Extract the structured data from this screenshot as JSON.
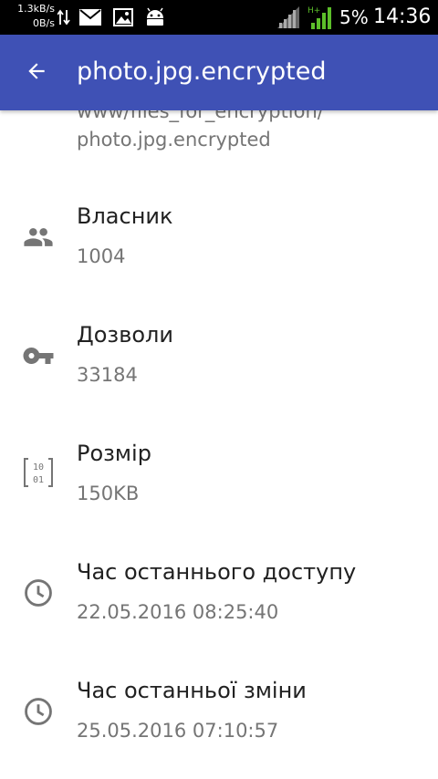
{
  "status_bar": {
    "net_up": "1.3kB/s",
    "net_down": "0B/s",
    "network_type": "H+",
    "battery_percent": "5%",
    "time": "14:36",
    "icons": [
      "data-transfer-icon",
      "mail-icon",
      "image-icon",
      "android-icon",
      "signal-icon",
      "mobile-signal-icon"
    ]
  },
  "app_bar": {
    "back_icon": "arrow-back-icon",
    "title": "photo.jpg.encrypted",
    "color": "#3f51b5"
  },
  "path": {
    "partial_line": "www/files_for_encryption/",
    "line2": "photo.jpg.encrypted"
  },
  "properties": [
    {
      "icon": "people-icon",
      "label": "Власник",
      "value": "1004"
    },
    {
      "icon": "key-icon",
      "label": "Дозволи",
      "value": "33184"
    },
    {
      "icon": "binary-icon",
      "label": "Розмір",
      "value": "150KB"
    },
    {
      "icon": "clock-icon",
      "label": "Час останнього доступу",
      "value": "22.05.2016 08:25:40"
    },
    {
      "icon": "clock-icon",
      "label": "Час останньої зміни",
      "value": "25.05.2016 07:10:57"
    }
  ],
  "colors": {
    "status_bar_bg": "#000000",
    "app_bar_bg": "#3f51b5",
    "label_text": "#212121",
    "secondary_text": "#757575",
    "icon_gray": "#757575",
    "signal_green": "#5cbf2a"
  }
}
